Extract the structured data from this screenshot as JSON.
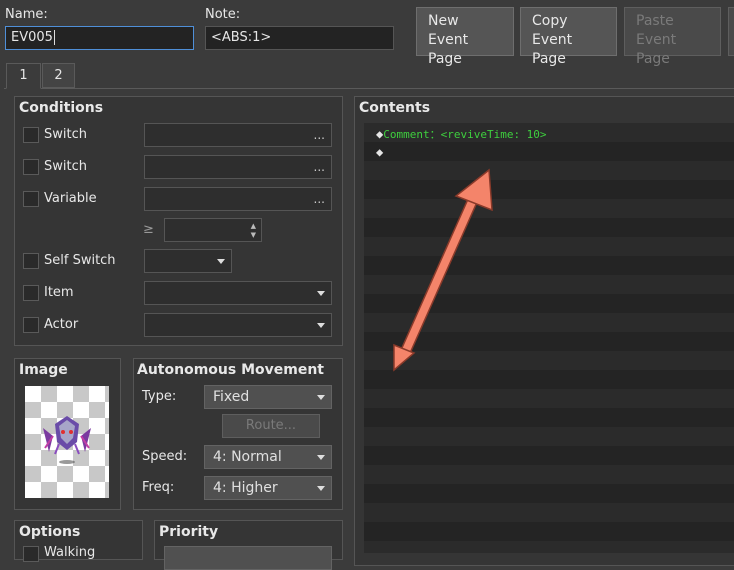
{
  "header": {
    "name_label": "Name:",
    "name_value": "EV005",
    "note_label": "Note:",
    "note_value": "<ABS:1>",
    "buttons": {
      "new_event_page": "New\nEvent Page",
      "copy_event_page": "Copy\nEvent Page",
      "paste_event_page": "Paste\nEvent Page"
    }
  },
  "tabs": [
    "1",
    "2"
  ],
  "conditions": {
    "title": "Conditions",
    "switch1": "Switch",
    "switch2": "Switch",
    "variable": "Variable",
    "gte": "≥",
    "self_switch": "Self Switch",
    "item": "Item",
    "actor": "Actor",
    "dots": "..."
  },
  "image": {
    "title": "Image"
  },
  "movement": {
    "title": "Autonomous Movement",
    "type_label": "Type:",
    "type_value": "Fixed",
    "route_button": "Route...",
    "speed_label": "Speed:",
    "speed_value": "4: Normal",
    "freq_label": "Freq:",
    "freq_value": "4: Higher"
  },
  "options": {
    "title": "Options",
    "walking": "Walking"
  },
  "priority": {
    "title": "Priority"
  },
  "contents": {
    "title": "Contents",
    "lines": [
      {
        "marker": "◆",
        "text": "Comment：<reviveTime: 10>",
        "color": "#3ecf3e"
      },
      {
        "marker": "◆",
        "text": "",
        "color": "#e6e6e6"
      }
    ]
  },
  "annotation": {
    "arrow_color": "#f4846a"
  }
}
